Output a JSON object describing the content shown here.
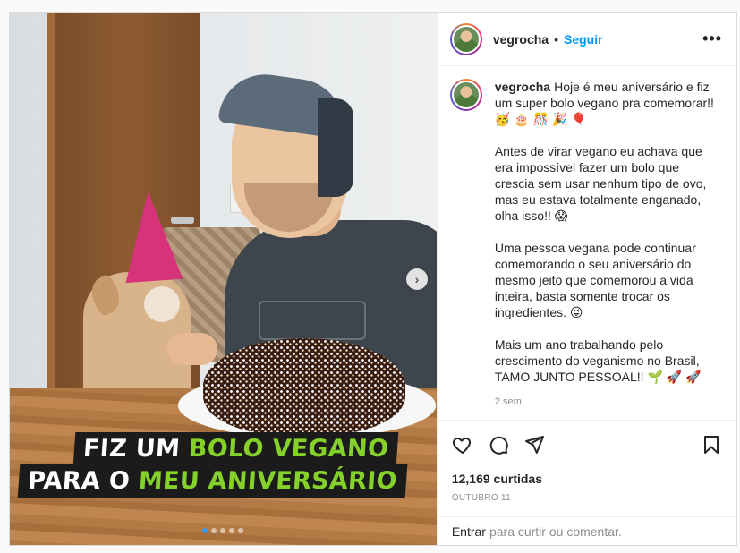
{
  "post": {
    "image": {
      "banner_line1_white": "FIZ UM",
      "banner_line1_green": "BOLO VEGANO",
      "banner_line2_white": "PARA O",
      "banner_line2_green": "MEU ANIVERSÁRIO",
      "next_icon": "chevron-right-icon",
      "carousel": {
        "count": 5,
        "active_index": 0
      }
    },
    "header": {
      "username": "vegrocha",
      "separator": "•",
      "follow_label": "Seguir",
      "more_label": "•••"
    },
    "caption": {
      "username": "vegrocha",
      "paragraphs": [
        "Hoje é meu aniversário e fiz um super bolo vegano pra comemorar!! 🥳 🎂 🎊 🎉 🎈",
        "Antes de virar vegano eu achava que era impossível fazer um bolo que crescia sem usar nenhum tipo de ovo, mas eu estava totalmente enganado, olha isso!! 😱",
        "Uma pessoa vegana pode continuar comemorando o seu aniversário do mesmo jeito que comemorou a vida inteira, basta somente trocar os ingredientes. 😜",
        "Mais um ano trabalhando pelo crescimento do veganismo no Brasil, TAMO JUNTO PESSOAL!! 🌱 🚀 🚀"
      ],
      "time": "2 sem"
    },
    "actions": {
      "like_icon": "heart-icon",
      "comment_icon": "comment-icon",
      "share_icon": "share-icon",
      "save_icon": "bookmark-icon"
    },
    "likes": "12,169 curtidas",
    "date": "OUTUBRO 11",
    "comment_bar": {
      "login_label": "Entrar",
      "prompt": "para curtir ou comentar."
    }
  }
}
